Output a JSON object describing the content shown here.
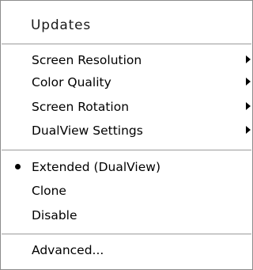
{
  "menu": {
    "header": "Updates",
    "groups": [
      {
        "items": [
          {
            "label": "Screen Resolution",
            "submenu": true
          },
          {
            "label": "Color Quality",
            "submenu": true
          },
          {
            "label": "Screen Rotation",
            "submenu": true
          },
          {
            "label": "DualView Settings",
            "submenu": true
          }
        ]
      },
      {
        "items": [
          {
            "label": "Extended (DualView)",
            "selected": true
          },
          {
            "label": "Clone",
            "selected": false
          },
          {
            "label": "Disable",
            "selected": false
          }
        ]
      },
      {
        "items": [
          {
            "label": "Advanced..."
          }
        ]
      }
    ]
  }
}
